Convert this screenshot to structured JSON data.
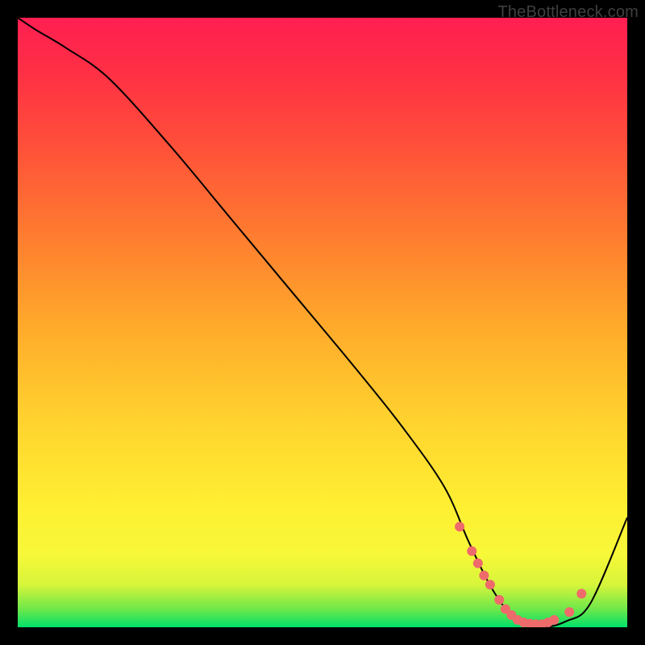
{
  "attribution": "TheBottleneck.com",
  "chart_data": {
    "type": "line",
    "title": "",
    "xlabel": "",
    "ylabel": "",
    "xlim": [
      0,
      100
    ],
    "ylim": [
      0,
      100
    ],
    "gradient_bands": [
      {
        "stop": 0.0,
        "color": "#00e06a"
      },
      {
        "stop": 0.03,
        "color": "#6fe84a"
      },
      {
        "stop": 0.07,
        "color": "#d7f53a"
      },
      {
        "stop": 0.12,
        "color": "#f7f838"
      },
      {
        "stop": 0.2,
        "color": "#ffef32"
      },
      {
        "stop": 0.35,
        "color": "#ffd02e"
      },
      {
        "stop": 0.5,
        "color": "#ffa82b"
      },
      {
        "stop": 0.65,
        "color": "#ff7a30"
      },
      {
        "stop": 0.8,
        "color": "#ff4d3a"
      },
      {
        "stop": 0.92,
        "color": "#ff2d46"
      },
      {
        "stop": 1.0,
        "color": "#ff1f52"
      }
    ],
    "curve": {
      "x": [
        0,
        3,
        8,
        15,
        25,
        35,
        45,
        55,
        63,
        70,
        74,
        78,
        82,
        86,
        90,
        94,
        100
      ],
      "y": [
        100,
        98,
        95,
        90,
        79,
        67,
        55,
        43,
        33,
        23,
        14,
        6,
        1,
        0,
        1,
        4,
        18
      ]
    },
    "flat_region_markers": {
      "x": [
        72.5,
        74.5,
        75.5,
        76.5,
        77.5,
        79,
        80,
        81,
        82,
        83,
        84,
        85,
        86,
        87,
        88,
        90.5,
        92.5
      ],
      "y": [
        16.5,
        12.5,
        10.5,
        8.5,
        7,
        4.5,
        3,
        2,
        1.2,
        0.8,
        0.6,
        0.5,
        0.5,
        0.8,
        1.2,
        2.5,
        5.5
      ],
      "color": "#ef6a6a",
      "radius": 6
    }
  }
}
